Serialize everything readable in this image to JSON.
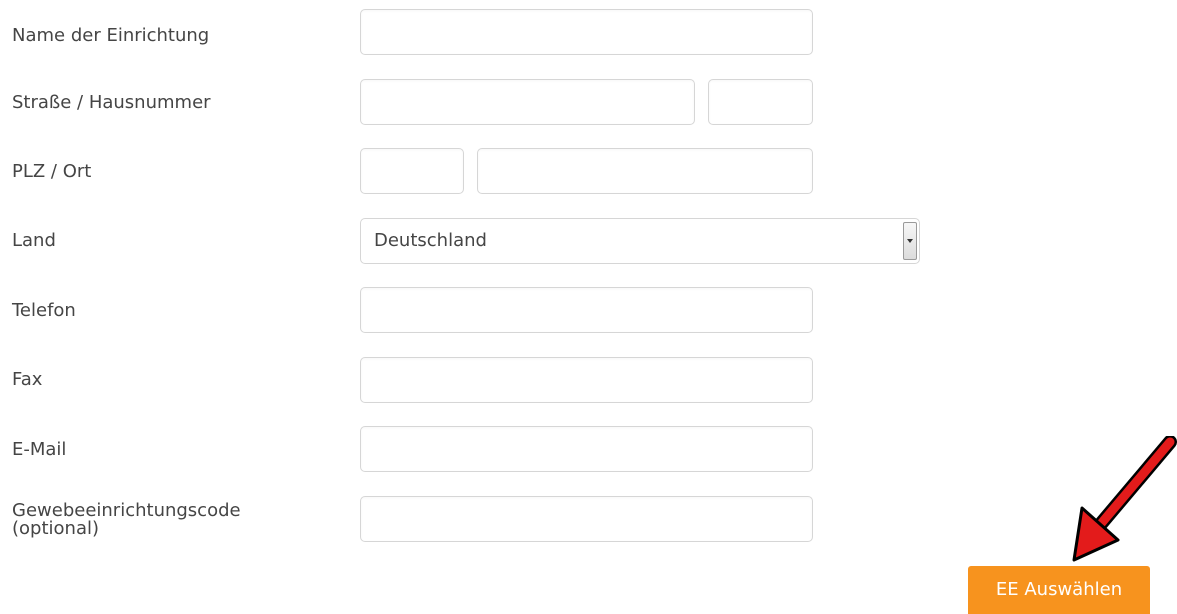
{
  "form": {
    "name_label": "Name der Einrichtung",
    "name_value": "",
    "street_label": "Straße / Hausnummer",
    "street_value": "",
    "house_number_value": "",
    "zip_city_label": "PLZ / Ort",
    "zip_value": "",
    "city_value": "",
    "country_label": "Land",
    "country_selected": "Deutschland",
    "phone_label": "Telefon",
    "phone_value": "",
    "fax_label": "Fax",
    "fax_value": "",
    "email_label": "E-Mail",
    "email_value": "",
    "tissue_code_label_line1": "Gewebeeinrichtungscode",
    "tissue_code_label_line2": "(optional)",
    "tissue_code_value": "",
    "submit_label": "EE Auswählen"
  },
  "colors": {
    "button_bg": "#f7931e",
    "annotation_arrow": "#e31b1b"
  },
  "icons": {
    "select_arrow": "chevron-down-icon",
    "annotation": "red-arrow-icon"
  }
}
